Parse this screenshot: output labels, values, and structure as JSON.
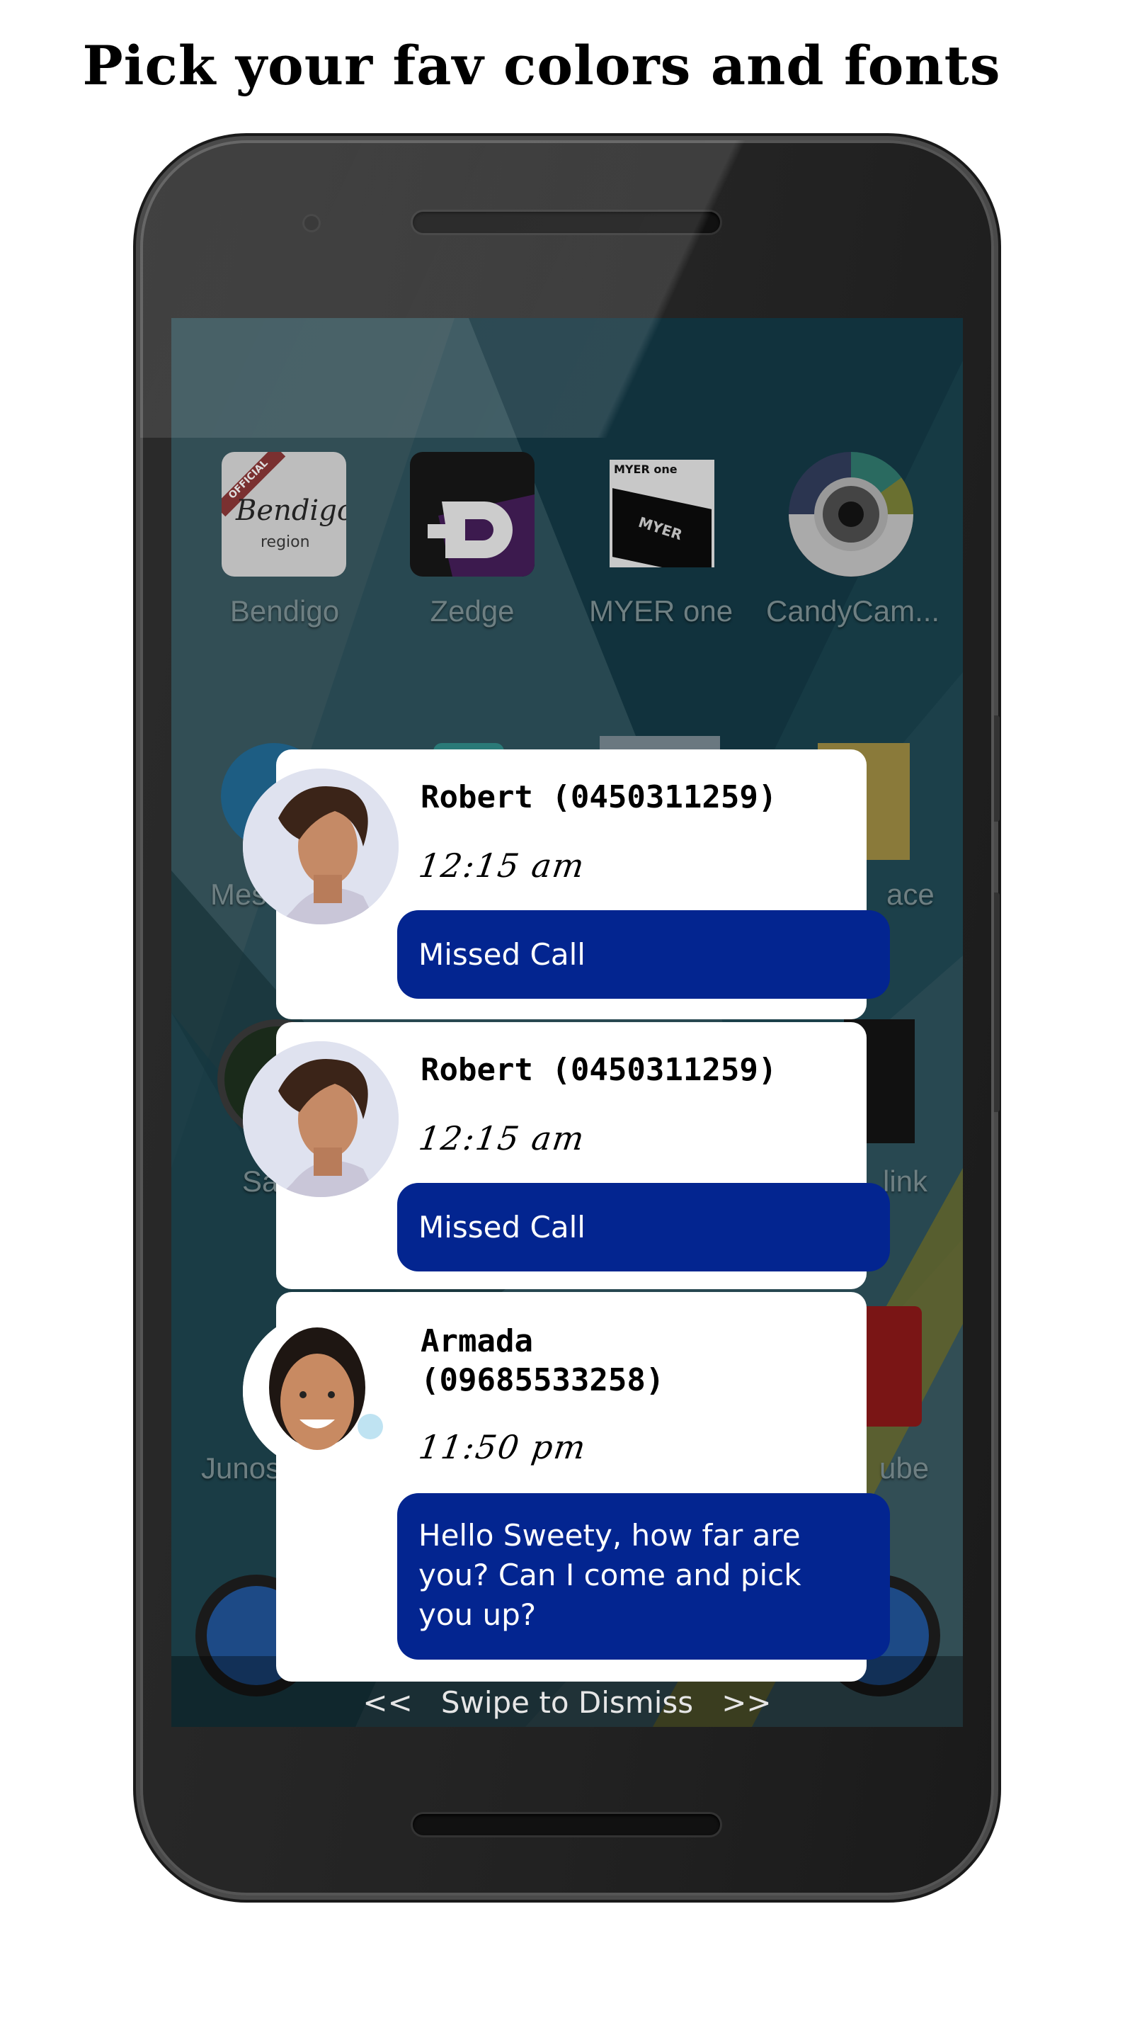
{
  "headline": "Pick your fav colors and fonts",
  "home_screen": {
    "apps": [
      {
        "label": "Bendigo",
        "icon": "bendigo-region-icon",
        "icon_text": [
          "OFFICIAL",
          "Bendigo",
          "region"
        ]
      },
      {
        "label": "Zedge",
        "icon": "zedge-icon"
      },
      {
        "label": "MYER one",
        "icon": "myer-one-icon",
        "icon_text": [
          "MYER one",
          "MYER"
        ]
      },
      {
        "label": "CandyCam...",
        "icon": "candycam-icon"
      }
    ],
    "partial_labels": {
      "row2_left": "Mes",
      "row2_right": "ace",
      "row3_left": "Sa",
      "row3_right": "link",
      "row4_left": "Junos",
      "row4_right": "ube"
    }
  },
  "notifications": [
    {
      "name": "Robert (0450311259)",
      "time": "12:15 am",
      "message": "Missed Call",
      "avatar": "male-contact-photo"
    },
    {
      "name": "Robert (0450311259)",
      "time": "12:15 am",
      "message": "Missed Call",
      "avatar": "male-contact-photo"
    },
    {
      "name": "Armada\n(09685533258)",
      "time": "11:50 pm",
      "message": "Hello Sweety, how far are you? Can I come and pick you up?",
      "avatar": "female-contact-photo"
    }
  ],
  "dismiss": {
    "left_arrows": "<<",
    "label": "Swipe to Dismiss",
    "right_arrows": ">>"
  },
  "colors": {
    "bubble": "#032590",
    "card": "#ffffff",
    "screen_bg": "#3a5c63"
  }
}
